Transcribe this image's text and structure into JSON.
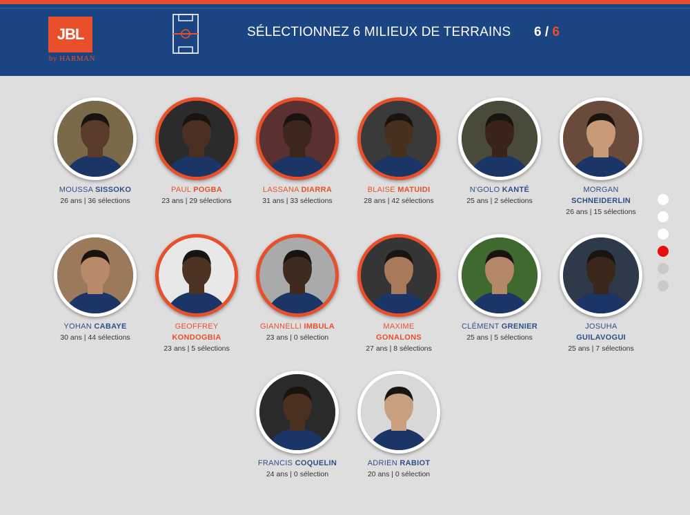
{
  "header": {
    "brand": "JBL",
    "brand_sub": "by HARMAN",
    "title": "SÉLECTIONNEZ 6 MILIEUX DE TERRAINS",
    "count_selected": "6",
    "count_sep": " / ",
    "count_total": "6"
  },
  "players": [
    {
      "first": "MOUSSA",
      "last": "SISSOKO",
      "info": "26 ans | 36 sélections",
      "selected": false
    },
    {
      "first": "PAUL",
      "last": "POGBA",
      "info": "23 ans | 29 sélections",
      "selected": true
    },
    {
      "first": "LASSANA",
      "last": "DIARRA",
      "info": "31 ans | 33 sélections",
      "selected": true
    },
    {
      "first": "BLAISE",
      "last": "MATUIDI",
      "info": "28 ans | 42 sélections",
      "selected": true
    },
    {
      "first": "N'GOLO",
      "last": "KANTÉ",
      "info": "25 ans | 2 sélections",
      "selected": false
    },
    {
      "first": "MORGAN",
      "last": "SCHNEIDERLIN",
      "info": "26 ans | 15 sélections",
      "selected": false
    },
    {
      "first": "YOHAN",
      "last": "CABAYE",
      "info": "30 ans | 44 sélections",
      "selected": false
    },
    {
      "first": "GEOFFREY",
      "last": "KONDOGBIA",
      "info": "23 ans | 5 sélections",
      "selected": true
    },
    {
      "first": "GIANNELLI",
      "last": "IMBULA",
      "info": "23 ans | 0 sélection",
      "selected": true
    },
    {
      "first": "MAXIME",
      "last": "GONALONS",
      "info": "27 ans | 8 sélections",
      "selected": true
    },
    {
      "first": "CLÉMENT",
      "last": "GRENIER",
      "info": "25 ans | 5 sélections",
      "selected": false
    },
    {
      "first": "JOSUHA",
      "last": "GUILAVOGUI",
      "info": "25 ans | 7 sélections",
      "selected": false
    },
    {
      "first": "FRANCIS",
      "last": "COQUELIN",
      "info": "24 ans | 0 sélection",
      "selected": false
    },
    {
      "first": "ADRIEN",
      "last": "RABIOT",
      "info": "20 ans | 0 sélection",
      "selected": false
    }
  ],
  "pagination": {
    "total": 6,
    "active": 4,
    "states": [
      "white",
      "white",
      "white",
      "active",
      "grey",
      "grey"
    ]
  },
  "colors": {
    "accent": "#e8502b",
    "navy": "#1b4483",
    "name_blue": "#2d4f88",
    "bg": "#dedede"
  }
}
